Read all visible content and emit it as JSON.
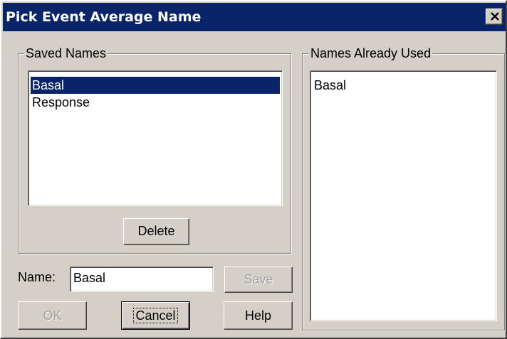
{
  "window": {
    "title": "Pick Event Average Name",
    "close_icon": "close-icon"
  },
  "saved_names": {
    "legend": "Saved Names",
    "items": [
      {
        "label": "Basal",
        "selected": true
      },
      {
        "label": "Response",
        "selected": false
      }
    ],
    "delete_label": "Delete"
  },
  "names_used": {
    "legend": "Names Already Used",
    "items": [
      {
        "label": "Basal"
      }
    ]
  },
  "name_field": {
    "label": "Name:",
    "value": "Basal"
  },
  "buttons": {
    "save_label": "Save",
    "ok_label": "OK",
    "cancel_label": "Cancel",
    "help_label": "Help"
  },
  "colors": {
    "titlebar": "#0a246a",
    "selection": "#0a246a",
    "face": "#d4d0c8"
  }
}
